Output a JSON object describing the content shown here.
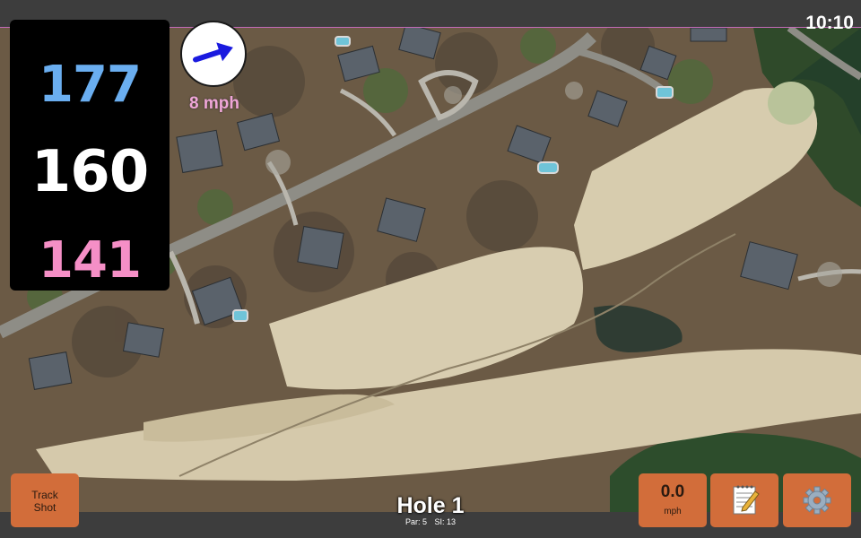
{
  "status": {
    "clock": "10:10"
  },
  "distances": {
    "back": "177",
    "middle": "160",
    "front": "141"
  },
  "wind": {
    "speed_label": "8 mph",
    "icon": "arrow-right-icon"
  },
  "hole": {
    "title": "Hole 1",
    "par_label": "Par: 5",
    "si_label": "SI: 13"
  },
  "buttons": {
    "track_shot_line1": "Track",
    "track_shot_line2": "Shot",
    "speed_value": "0.0",
    "speed_unit": "mph",
    "notes_icon": "notepad-icon",
    "settings_icon": "gear-icon"
  },
  "colors": {
    "back_distance": "#6aaef0",
    "middle_distance": "#ffffff",
    "front_distance": "#f58fc6",
    "button": "#d26d3a",
    "wind_text": "#f0a6d8"
  }
}
